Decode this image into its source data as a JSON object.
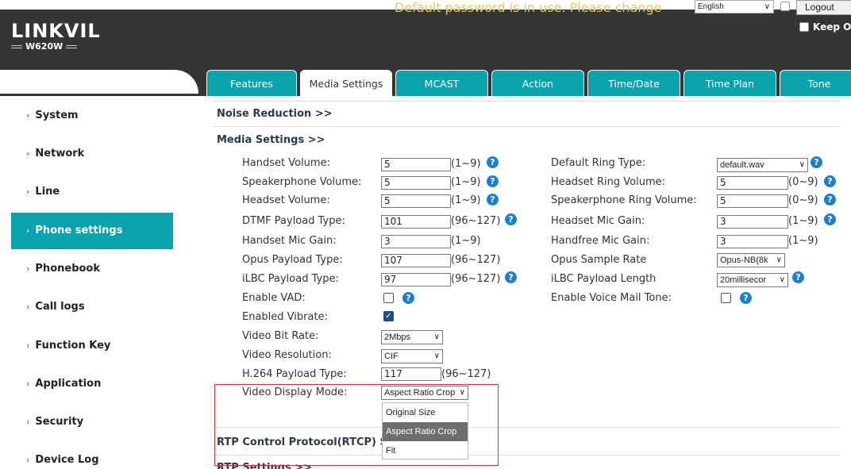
{
  "header": {
    "logo_main": "LINKVIL",
    "logo_model": "W620W",
    "warning": "Default password is in use. Please change",
    "language": "English",
    "logout": "Logout",
    "keep_label": "Keep O"
  },
  "tabs": [
    {
      "label": "Features",
      "active": false
    },
    {
      "label": "Media Settings",
      "active": true
    },
    {
      "label": "MCAST",
      "active": false
    },
    {
      "label": "Action",
      "active": false
    },
    {
      "label": "Time/Date",
      "active": false
    },
    {
      "label": "Time Plan",
      "active": false
    },
    {
      "label": "Tone",
      "active": false
    }
  ],
  "sidebar": {
    "items": [
      {
        "label": "System"
      },
      {
        "label": "Network"
      },
      {
        "label": "Line"
      },
      {
        "label": "Phone settings",
        "active": true
      },
      {
        "label": "Phonebook"
      },
      {
        "label": "Call logs"
      },
      {
        "label": "Function Key"
      },
      {
        "label": "Application"
      },
      {
        "label": "Security"
      },
      {
        "label": "Device Log"
      }
    ]
  },
  "sections": {
    "noise_reduction": "Noise Reduction >>",
    "media_settings": "Media Settings >>",
    "rtcp": "RTP Control Protocol(RTCP) Se",
    "rtp_settings": "RTP Settings >>"
  },
  "left_fields": {
    "handset_volume": {
      "label": "Handset Volume:",
      "value": "5",
      "range": "(1~9)"
    },
    "speakerphone_volume": {
      "label": "Speakerphone Volume:",
      "value": "5",
      "range": "(1~9)"
    },
    "headset_volume": {
      "label": "Headset Volume:",
      "value": "5",
      "range": "(1~9)"
    },
    "dtmf_payload": {
      "label": "DTMF Payload Type:",
      "value": "101",
      "range": "(96~127)"
    },
    "handset_mic_gain": {
      "label": "Handset Mic Gain:",
      "value": "3",
      "range": "(1~9)"
    },
    "opus_payload": {
      "label": "Opus Payload Type:",
      "value": "107",
      "range": "(96~127)"
    },
    "ilbc_payload": {
      "label": "iLBC Payload Type:",
      "value": "97",
      "range": "(96~127)"
    },
    "enable_vad": {
      "label": "Enable VAD:"
    },
    "enabled_vibrate": {
      "label": "Enabled Vibrate:"
    },
    "video_bit_rate": {
      "label": "Video Bit Rate:",
      "value": "2Mbps"
    },
    "video_resolution": {
      "label": "Video Resolution:",
      "value": "CIF"
    },
    "h264_payload": {
      "label": "H.264 Payload Type:",
      "value": "117",
      "range": "(96~127)"
    },
    "video_display_mode": {
      "label": "Video Display Mode:",
      "value": "Aspect Ratio Crop"
    }
  },
  "right_fields": {
    "default_ring_type": {
      "label": "Default Ring Type:",
      "value": "default.wav"
    },
    "headset_ring_volume": {
      "label": "Headset Ring Volume:",
      "value": "5",
      "range": "(0~9)"
    },
    "speakerphone_ring_volume": {
      "label": "Speakerphone Ring Volume:",
      "value": "5",
      "range": "(0~9)"
    },
    "headset_mic_gain": {
      "label": "Headset Mic Gain:",
      "value": "3",
      "range": "(1~9)"
    },
    "handfree_mic_gain": {
      "label": "Handfree Mic Gain:",
      "value": "3",
      "range": "(1~9)"
    },
    "opus_sample_rate": {
      "label": "Opus Sample Rate",
      "value": "Opus-NB(8k"
    },
    "ilbc_payload_length": {
      "label": "iLBC Payload Length",
      "value": "20millisecor"
    },
    "enable_voice_mail_tone": {
      "label": "Enable Voice Mail Tone:"
    }
  },
  "dropdown_options": [
    "Original Size",
    "Aspect Ratio Crop",
    "Fit"
  ],
  "help_glyph": "?",
  "colors": {
    "header_bg": "#353535",
    "accent": "#0aa2ad",
    "warning": "#e8c95a",
    "help": "#1d7fcf",
    "highlight": "#d9342b"
  }
}
